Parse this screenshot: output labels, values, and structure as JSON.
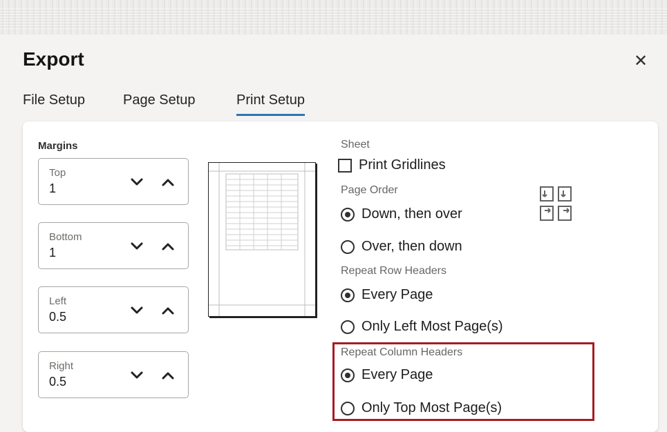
{
  "dialog": {
    "title": "Export",
    "close_icon": "close-icon"
  },
  "tabs": [
    {
      "label": "File Setup",
      "active": false
    },
    {
      "label": "Page Setup",
      "active": false
    },
    {
      "label": "Print Setup",
      "active": true
    }
  ],
  "margins": {
    "section_label": "Margins",
    "fields": [
      {
        "label": "Top",
        "value": "1"
      },
      {
        "label": "Bottom",
        "value": "1"
      },
      {
        "label": "Left",
        "value": "0.5"
      },
      {
        "label": "Right",
        "value": "0.5"
      }
    ],
    "decrement_icon": "chevron-down-icon",
    "increment_icon": "chevron-up-icon"
  },
  "sheet": {
    "label": "Sheet",
    "print_gridlines": {
      "label": "Print Gridlines",
      "checked": false
    }
  },
  "page_order": {
    "label": "Page Order",
    "options": [
      {
        "label": "Down, then over",
        "checked": true
      },
      {
        "label": "Over, then down",
        "checked": false
      }
    ],
    "icon": "page-order-icon"
  },
  "repeat_row_headers": {
    "label": "Repeat Row Headers",
    "options": [
      {
        "label": "Every Page",
        "checked": true
      },
      {
        "label": "Only Left Most Page(s)",
        "checked": false
      }
    ]
  },
  "repeat_column_headers": {
    "label": "Repeat Column Headers",
    "options": [
      {
        "label": "Every Page",
        "checked": true
      },
      {
        "label": "Only Top Most Page(s)",
        "checked": false
      }
    ]
  },
  "colors": {
    "active_tab_underline": "#2f74b5",
    "highlight_border": "#a51c24"
  }
}
